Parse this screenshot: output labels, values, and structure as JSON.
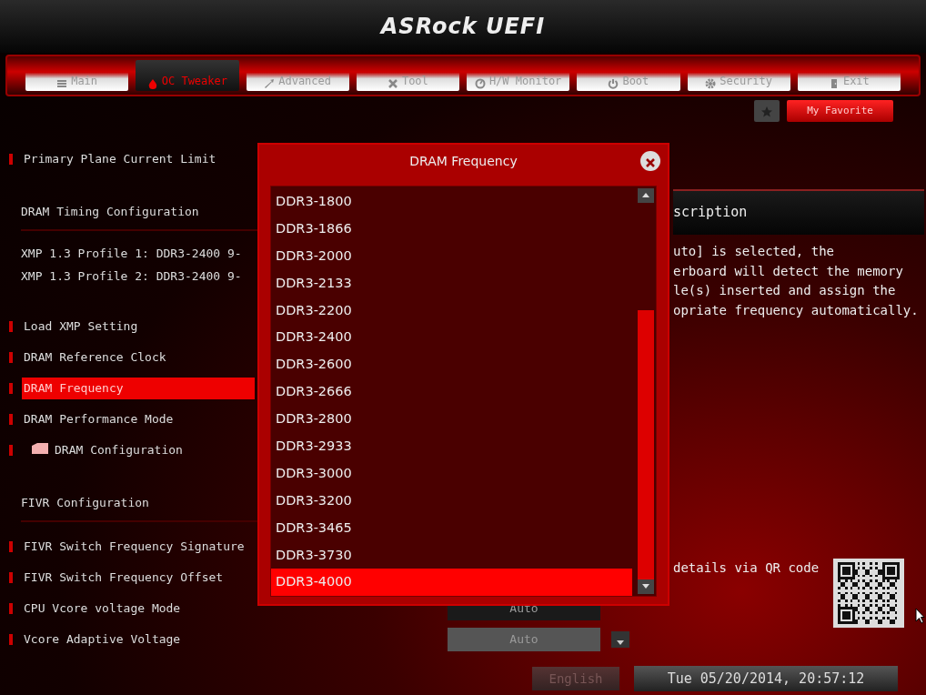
{
  "header": {
    "logo": "ASRock UEFI"
  },
  "tabs": [
    {
      "label": "Main",
      "selected": false
    },
    {
      "label": "OC Tweaker",
      "selected": true
    },
    {
      "label": "Advanced",
      "selected": false
    },
    {
      "label": "Tool",
      "selected": false
    },
    {
      "label": "H/W Monitor",
      "selected": false
    },
    {
      "label": "Boot",
      "selected": false
    },
    {
      "label": "Security",
      "selected": false
    },
    {
      "label": "Exit",
      "selected": false
    }
  ],
  "favorite_button": "My Favorite",
  "settings": [
    {
      "kind": "setting",
      "label": "Primary Plane Current Limit",
      "selected": false
    },
    {
      "kind": "header",
      "label": "DRAM Timing Configuration"
    },
    {
      "kind": "info",
      "label": "XMP 1.3 Profile 1: DDR3-2400 9-"
    },
    {
      "kind": "info",
      "label": "XMP 1.3 Profile 2: DDR3-2400 9-"
    },
    {
      "kind": "setting",
      "label": "Load XMP Setting",
      "selected": false
    },
    {
      "kind": "setting",
      "label": "DRAM Reference Clock",
      "selected": false
    },
    {
      "kind": "setting",
      "label": "DRAM Frequency",
      "selected": true
    },
    {
      "kind": "setting",
      "label": "DRAM Performance Mode",
      "selected": false
    },
    {
      "kind": "submenu",
      "label": "DRAM Configuration",
      "selected": false
    },
    {
      "kind": "header",
      "label": "FIVR Configuration"
    },
    {
      "kind": "setting",
      "label": "FIVR Switch Frequency Signature",
      "selected": false
    },
    {
      "kind": "setting",
      "label": "FIVR Switch Frequency Offset",
      "selected": false
    },
    {
      "kind": "setting",
      "label": "CPU Vcore voltage Mode",
      "selected": false,
      "value": "Auto"
    },
    {
      "kind": "setting",
      "label": "Vcore Adaptive Voltage",
      "selected": false,
      "value": "Auto",
      "dropdown": true
    }
  ],
  "description": {
    "title": "scription",
    "lines": [
      "uto] is selected, the",
      "erboard will detect the memory",
      "le(s) inserted and assign the",
      "opriate frequency automatically."
    ],
    "qr_caption": "details via QR code"
  },
  "dialog": {
    "title": "DRAM Frequency",
    "options": [
      {
        "label": "DDR3-1800",
        "selected": false
      },
      {
        "label": "DDR3-1866",
        "selected": false
      },
      {
        "label": "DDR3-2000",
        "selected": false
      },
      {
        "label": "DDR3-2133",
        "selected": false
      },
      {
        "label": "DDR3-2200",
        "selected": false
      },
      {
        "label": "DDR3-2400",
        "selected": false
      },
      {
        "label": "DDR3-2600",
        "selected": false
      },
      {
        "label": "DDR3-2666",
        "selected": false
      },
      {
        "label": "DDR3-2800",
        "selected": false
      },
      {
        "label": "DDR3-2933",
        "selected": false
      },
      {
        "label": "DDR3-3000",
        "selected": false
      },
      {
        "label": "DDR3-3200",
        "selected": false
      },
      {
        "label": "DDR3-3465",
        "selected": false
      },
      {
        "label": "DDR3-3730",
        "selected": false
      },
      {
        "label": "DDR3-4000",
        "selected": true
      }
    ]
  },
  "status_bar": {
    "language": "English",
    "datetime": "Tue 05/20/2014, 20:57:12"
  }
}
